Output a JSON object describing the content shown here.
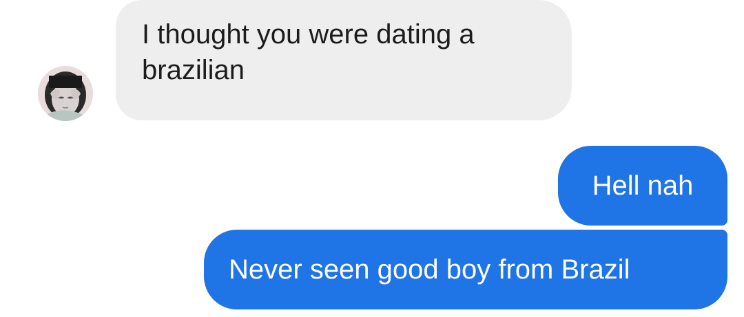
{
  "conversation": {
    "messages": [
      {
        "sender": "contact",
        "text": "I thought you were dating a brazilian"
      },
      {
        "sender": "me",
        "text": "Hell nah"
      },
      {
        "sender": "me",
        "text": "Never seen good boy from Brazil"
      }
    ]
  },
  "avatar": {
    "icon": "profile-photo-avatar"
  },
  "colors": {
    "incoming_bubble": "#eeeeee",
    "outgoing_bubble": "#1f74e6",
    "incoming_text": "#1c1c1c",
    "outgoing_text": "#ffffff"
  }
}
